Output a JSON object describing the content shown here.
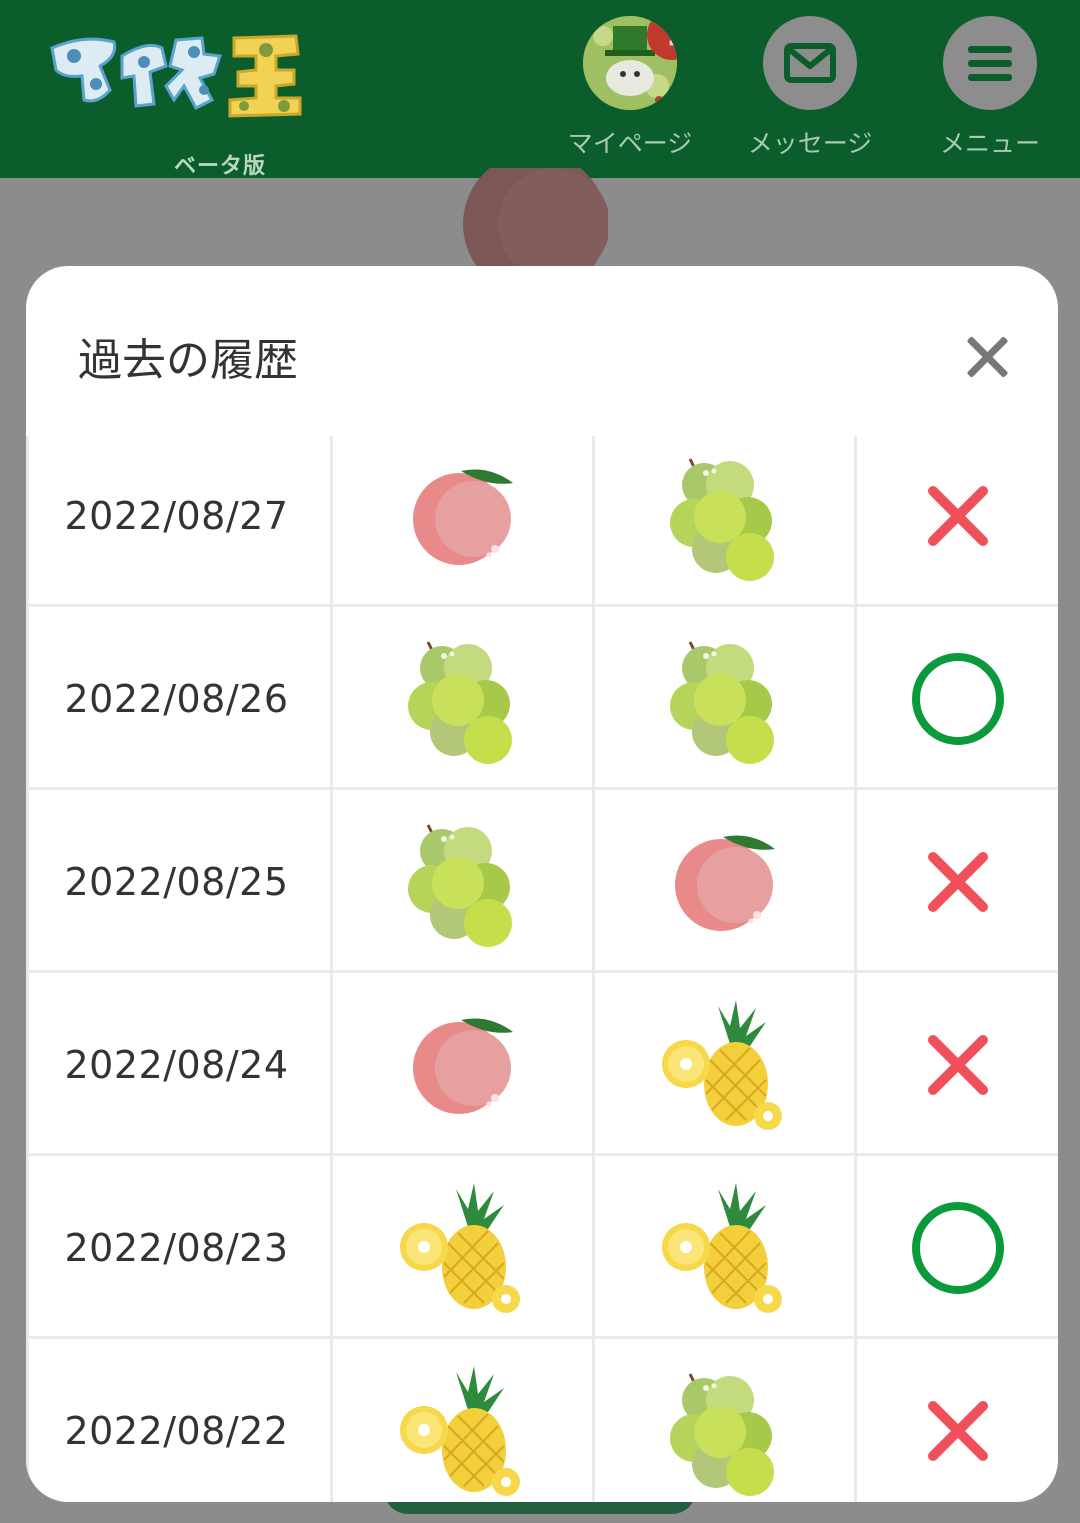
{
  "header": {
    "logo_text": "マイネ王",
    "logo_sub": "ベータ版",
    "nav": [
      {
        "label": "マイページ",
        "icon": "avatar-icon",
        "badge": "!"
      },
      {
        "label": "メッセージ",
        "icon": "envelope-icon"
      },
      {
        "label": "メニュー",
        "icon": "hamburger-icon"
      }
    ]
  },
  "modal": {
    "title": "過去の履歴",
    "close_icon": "close-icon"
  },
  "history": [
    {
      "date": "2022/08/27",
      "fruit1": "peach",
      "fruit2": "grape",
      "result": "wrong"
    },
    {
      "date": "2022/08/26",
      "fruit1": "grape",
      "fruit2": "grape",
      "result": "correct"
    },
    {
      "date": "2022/08/25",
      "fruit1": "grape",
      "fruit2": "peach",
      "result": "wrong"
    },
    {
      "date": "2022/08/24",
      "fruit1": "peach",
      "fruit2": "pineapple",
      "result": "wrong"
    },
    {
      "date": "2022/08/23",
      "fruit1": "pineapple",
      "fruit2": "pineapple",
      "result": "correct"
    },
    {
      "date": "2022/08/22",
      "fruit1": "pineapple",
      "fruit2": "grape",
      "result": "wrong"
    }
  ],
  "colors": {
    "header_bg": "#0b5e2c",
    "correct": "#0a9a3c",
    "wrong": "#f0505a"
  }
}
